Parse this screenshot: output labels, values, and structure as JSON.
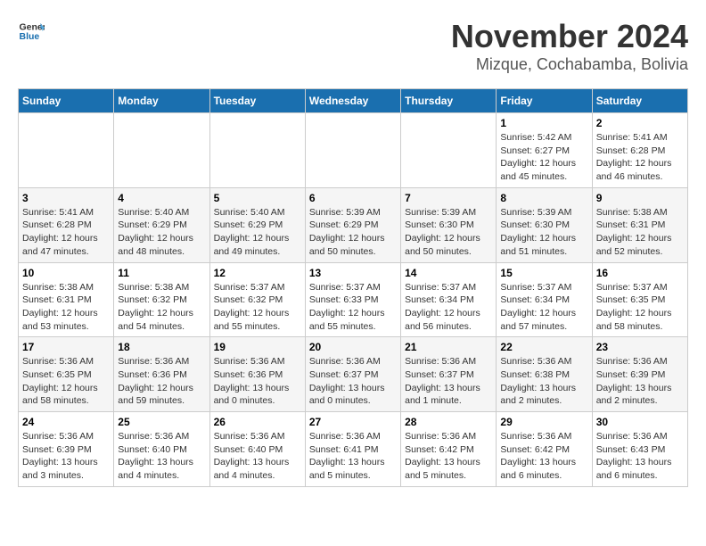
{
  "logo": {
    "general": "General",
    "blue": "Blue"
  },
  "title": "November 2024",
  "location": "Mizque, Cochabamba, Bolivia",
  "days_of_week": [
    "Sunday",
    "Monday",
    "Tuesday",
    "Wednesday",
    "Thursday",
    "Friday",
    "Saturday"
  ],
  "weeks": [
    [
      {
        "day": "",
        "info": ""
      },
      {
        "day": "",
        "info": ""
      },
      {
        "day": "",
        "info": ""
      },
      {
        "day": "",
        "info": ""
      },
      {
        "day": "",
        "info": ""
      },
      {
        "day": "1",
        "info": "Sunrise: 5:42 AM\nSunset: 6:27 PM\nDaylight: 12 hours and 45 minutes."
      },
      {
        "day": "2",
        "info": "Sunrise: 5:41 AM\nSunset: 6:28 PM\nDaylight: 12 hours and 46 minutes."
      }
    ],
    [
      {
        "day": "3",
        "info": "Sunrise: 5:41 AM\nSunset: 6:28 PM\nDaylight: 12 hours and 47 minutes."
      },
      {
        "day": "4",
        "info": "Sunrise: 5:40 AM\nSunset: 6:29 PM\nDaylight: 12 hours and 48 minutes."
      },
      {
        "day": "5",
        "info": "Sunrise: 5:40 AM\nSunset: 6:29 PM\nDaylight: 12 hours and 49 minutes."
      },
      {
        "day": "6",
        "info": "Sunrise: 5:39 AM\nSunset: 6:29 PM\nDaylight: 12 hours and 50 minutes."
      },
      {
        "day": "7",
        "info": "Sunrise: 5:39 AM\nSunset: 6:30 PM\nDaylight: 12 hours and 50 minutes."
      },
      {
        "day": "8",
        "info": "Sunrise: 5:39 AM\nSunset: 6:30 PM\nDaylight: 12 hours and 51 minutes."
      },
      {
        "day": "9",
        "info": "Sunrise: 5:38 AM\nSunset: 6:31 PM\nDaylight: 12 hours and 52 minutes."
      }
    ],
    [
      {
        "day": "10",
        "info": "Sunrise: 5:38 AM\nSunset: 6:31 PM\nDaylight: 12 hours and 53 minutes."
      },
      {
        "day": "11",
        "info": "Sunrise: 5:38 AM\nSunset: 6:32 PM\nDaylight: 12 hours and 54 minutes."
      },
      {
        "day": "12",
        "info": "Sunrise: 5:37 AM\nSunset: 6:32 PM\nDaylight: 12 hours and 55 minutes."
      },
      {
        "day": "13",
        "info": "Sunrise: 5:37 AM\nSunset: 6:33 PM\nDaylight: 12 hours and 55 minutes."
      },
      {
        "day": "14",
        "info": "Sunrise: 5:37 AM\nSunset: 6:34 PM\nDaylight: 12 hours and 56 minutes."
      },
      {
        "day": "15",
        "info": "Sunrise: 5:37 AM\nSunset: 6:34 PM\nDaylight: 12 hours and 57 minutes."
      },
      {
        "day": "16",
        "info": "Sunrise: 5:37 AM\nSunset: 6:35 PM\nDaylight: 12 hours and 58 minutes."
      }
    ],
    [
      {
        "day": "17",
        "info": "Sunrise: 5:36 AM\nSunset: 6:35 PM\nDaylight: 12 hours and 58 minutes."
      },
      {
        "day": "18",
        "info": "Sunrise: 5:36 AM\nSunset: 6:36 PM\nDaylight: 12 hours and 59 minutes."
      },
      {
        "day": "19",
        "info": "Sunrise: 5:36 AM\nSunset: 6:36 PM\nDaylight: 13 hours and 0 minutes."
      },
      {
        "day": "20",
        "info": "Sunrise: 5:36 AM\nSunset: 6:37 PM\nDaylight: 13 hours and 0 minutes."
      },
      {
        "day": "21",
        "info": "Sunrise: 5:36 AM\nSunset: 6:37 PM\nDaylight: 13 hours and 1 minute."
      },
      {
        "day": "22",
        "info": "Sunrise: 5:36 AM\nSunset: 6:38 PM\nDaylight: 13 hours and 2 minutes."
      },
      {
        "day": "23",
        "info": "Sunrise: 5:36 AM\nSunset: 6:39 PM\nDaylight: 13 hours and 2 minutes."
      }
    ],
    [
      {
        "day": "24",
        "info": "Sunrise: 5:36 AM\nSunset: 6:39 PM\nDaylight: 13 hours and 3 minutes."
      },
      {
        "day": "25",
        "info": "Sunrise: 5:36 AM\nSunset: 6:40 PM\nDaylight: 13 hours and 4 minutes."
      },
      {
        "day": "26",
        "info": "Sunrise: 5:36 AM\nSunset: 6:40 PM\nDaylight: 13 hours and 4 minutes."
      },
      {
        "day": "27",
        "info": "Sunrise: 5:36 AM\nSunset: 6:41 PM\nDaylight: 13 hours and 5 minutes."
      },
      {
        "day": "28",
        "info": "Sunrise: 5:36 AM\nSunset: 6:42 PM\nDaylight: 13 hours and 5 minutes."
      },
      {
        "day": "29",
        "info": "Sunrise: 5:36 AM\nSunset: 6:42 PM\nDaylight: 13 hours and 6 minutes."
      },
      {
        "day": "30",
        "info": "Sunrise: 5:36 AM\nSunset: 6:43 PM\nDaylight: 13 hours and 6 minutes."
      }
    ]
  ]
}
